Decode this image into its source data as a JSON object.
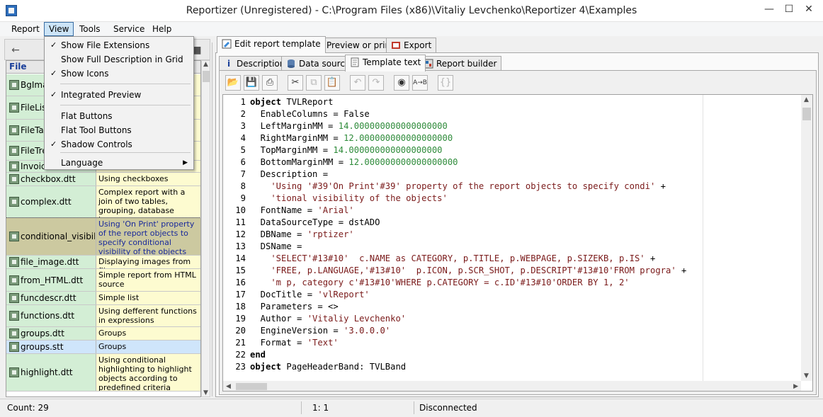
{
  "window": {
    "title": "Reportizer (Unregistered) - C:\\Program Files (x86)\\Vitaliy Levchenko\\Reportizer 4\\Examples",
    "controls": {
      "minimize": "—",
      "maximize": "☐",
      "close": "✕"
    }
  },
  "menubar": {
    "items": [
      "Report",
      "View",
      "Tools",
      "Service",
      "Help"
    ],
    "open_menu": "View"
  },
  "view_menu": {
    "items": [
      {
        "label": "Show File Extensions",
        "checked": "✓"
      },
      {
        "label": "Show Full Description in Grid",
        "checked": ""
      },
      {
        "label": "Show Icons",
        "checked": "✓"
      },
      {
        "label": "Integrated Preview",
        "checked": "✓"
      },
      {
        "label": "Flat Buttons",
        "checked": ""
      },
      {
        "label": "Flat Tool Buttons",
        "checked": ""
      },
      {
        "label": "Shadow Controls",
        "checked": "✓"
      },
      {
        "label": "Language",
        "checked": "",
        "submenu_arrow": "▶"
      }
    ]
  },
  "file_grid": {
    "header": "File",
    "rows": [
      {
        "file": "BgIma",
        "desc": ""
      },
      {
        "file": "FileList",
        "desc": ""
      },
      {
        "file": "FileTab",
        "desc": ""
      },
      {
        "file": "FileTre",
        "desc": ""
      },
      {
        "file": "Invoic",
        "desc": ""
      },
      {
        "file": "checkbox.dtt",
        "desc": "Using checkboxes"
      },
      {
        "file": "complex.dtt",
        "desc": "Complex report with a join of two tables, grouping, database images"
      },
      {
        "file": "conditional_visibilit...",
        "desc": "Using 'On Print' property of the report objects to specify conditional visibility of the objects",
        "state": "selected"
      },
      {
        "file": "file_image.dtt",
        "desc": "Displaying images from files"
      },
      {
        "file": "from_HTML.dtt",
        "desc": "Simple report from HTML source"
      },
      {
        "file": "funcdescr.dtt",
        "desc": "Simple list"
      },
      {
        "file": "functions.dtt",
        "desc": "Using defferent functions in expressions"
      },
      {
        "file": "groups.dtt",
        "desc": "Groups"
      },
      {
        "file": "groups.stt",
        "desc": "Groups",
        "state": "hover"
      },
      {
        "file": "highlight.dtt",
        "desc": "Using conditional highlighting to highlight objects according to predefined criteria"
      }
    ]
  },
  "main_tabs": {
    "items": [
      "Edit report template",
      "Preview or print",
      "Export"
    ],
    "active": "Edit report template"
  },
  "sub_tabs": {
    "items": [
      "Description",
      "Data source",
      "Template text",
      "Report builder"
    ],
    "active": "Template text"
  },
  "editor": {
    "lines": [
      {
        "n": "1",
        "parts": [
          {
            "t": "object",
            "c": "kw"
          },
          {
            "t": " TVLReport",
            "c": ""
          }
        ]
      },
      {
        "n": "2",
        "parts": [
          {
            "t": "  EnableColumns = False",
            "c": ""
          }
        ]
      },
      {
        "n": "3",
        "parts": [
          {
            "t": "  LeftMarginMM = ",
            "c": ""
          },
          {
            "t": "14.000000000000000000",
            "c": "num"
          }
        ]
      },
      {
        "n": "4",
        "parts": [
          {
            "t": "  RightMarginMM = ",
            "c": ""
          },
          {
            "t": "12.000000000000000000",
            "c": "num"
          }
        ]
      },
      {
        "n": "5",
        "parts": [
          {
            "t": "  TopMarginMM = ",
            "c": ""
          },
          {
            "t": "14.000000000000000000",
            "c": "num"
          }
        ]
      },
      {
        "n": "6",
        "parts": [
          {
            "t": "  BottomMarginMM = ",
            "c": ""
          },
          {
            "t": "12.000000000000000000",
            "c": "num"
          }
        ]
      },
      {
        "n": "7",
        "parts": [
          {
            "t": "  Description =",
            "c": ""
          }
        ]
      },
      {
        "n": "8",
        "parts": [
          {
            "t": "    'Using '#39'On Print'#39' property of the report objects to specify condi'",
            "c": "str"
          },
          {
            "t": " +",
            "c": ""
          }
        ]
      },
      {
        "n": "9",
        "parts": [
          {
            "t": "    'tional visibility of the objects'",
            "c": "str"
          }
        ]
      },
      {
        "n": "10",
        "parts": [
          {
            "t": "  FontName = ",
            "c": ""
          },
          {
            "t": "'Arial'",
            "c": "str"
          }
        ]
      },
      {
        "n": "11",
        "parts": [
          {
            "t": "  DataSourceType = dstADO",
            "c": ""
          }
        ]
      },
      {
        "n": "12",
        "parts": [
          {
            "t": "  DBName = ",
            "c": ""
          },
          {
            "t": "'rptizer'",
            "c": "str"
          }
        ]
      },
      {
        "n": "13",
        "parts": [
          {
            "t": "  DSName =",
            "c": ""
          }
        ]
      },
      {
        "n": "14",
        "parts": [
          {
            "t": "    'SELECT'#13#10'  c.NAME as CATEGORY, p.TITLE, p.WEBPAGE, p.SIZEKB, p.IS'",
            "c": "str"
          },
          {
            "t": " +",
            "c": ""
          }
        ]
      },
      {
        "n": "15",
        "parts": [
          {
            "t": "    'FREE, p.LANGUAGE,'#13#10'  p.ICON, p.SCR_SHOT, p.DESCRIPT'#13#10'FROM progra'",
            "c": "str"
          },
          {
            "t": " +",
            "c": ""
          }
        ]
      },
      {
        "n": "16",
        "parts": [
          {
            "t": "    'm p, category c'#13#10'WHERE p.CATEGORY = c.ID'#13#10'ORDER BY 1, 2'",
            "c": "str"
          }
        ]
      },
      {
        "n": "17",
        "parts": [
          {
            "t": "  DocTitle = ",
            "c": ""
          },
          {
            "t": "'vlReport'",
            "c": "str"
          }
        ]
      },
      {
        "n": "18",
        "parts": [
          {
            "t": "  Parameters = <>",
            "c": ""
          }
        ]
      },
      {
        "n": "19",
        "parts": [
          {
            "t": "  Author = ",
            "c": ""
          },
          {
            "t": "'Vitaliy Levchenko'",
            "c": "str"
          }
        ]
      },
      {
        "n": "20",
        "parts": [
          {
            "t": "  EngineVersion = ",
            "c": ""
          },
          {
            "t": "'3.0.0.0'",
            "c": "str"
          }
        ]
      },
      {
        "n": "21",
        "parts": [
          {
            "t": "  Format = ",
            "c": ""
          },
          {
            "t": "'Text'",
            "c": "str"
          }
        ]
      },
      {
        "n": "22",
        "parts": [
          {
            "t": "end",
            "c": "kw"
          }
        ]
      },
      {
        "n": "23",
        "parts": [
          {
            "t": "object",
            "c": "kw"
          },
          {
            "t": " PageHeaderBand: TVLBand",
            "c": ""
          }
        ]
      }
    ]
  },
  "statusbar": {
    "count": "Count: 29",
    "position": "1:  1",
    "connection": "Disconnected"
  },
  "colors": {
    "file_cell": "#d3eed5",
    "desc_cell": "#fdfbd0",
    "number_literal": "#2e8b3a",
    "string_literal": "#7a1a1a"
  }
}
